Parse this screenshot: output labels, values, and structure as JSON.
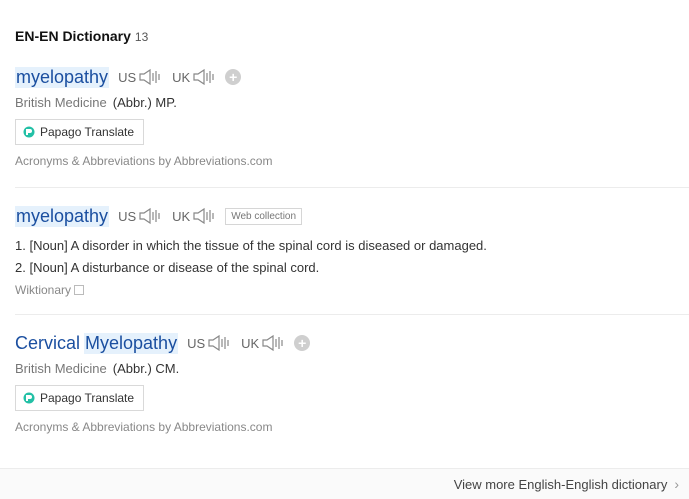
{
  "section": {
    "title": "EN-EN Dictionary",
    "count": "13"
  },
  "entries": [
    {
      "word": "myelopathy",
      "us": "US",
      "uk": "UK",
      "field_label": "British Medicine",
      "field_value": "(Abbr.) MP.",
      "translate_label": "Papago Translate",
      "source": "Acronyms & Abbreviations by Abbreviations.com"
    },
    {
      "word": "myelopathy",
      "us": "US",
      "uk": "UK",
      "badge": "Web collection",
      "definitions": [
        "1. [Noun] A disorder in which the tissue of the spinal cord is diseased or damaged.",
        "2. [Noun] A disturbance or disease of the spinal cord."
      ],
      "source": "Wiktionary"
    },
    {
      "word_part1": "Cervical",
      "word_part2": "Myelopathy",
      "us": "US",
      "uk": "UK",
      "field_label": "British Medicine",
      "field_value": "(Abbr.) CM.",
      "translate_label": "Papago Translate",
      "source": "Acronyms & Abbreviations by Abbreviations.com"
    }
  ],
  "footer": {
    "view_more": "View more English-English dictionary"
  },
  "icons": {
    "speaker": "speaker-icon",
    "plus": "add-icon",
    "papago": "papago-icon",
    "copy": "copy-icon",
    "chevron": "chevron-right-icon"
  },
  "colors": {
    "word": "#1b4fa0",
    "highlight": "#e5f1fc"
  }
}
